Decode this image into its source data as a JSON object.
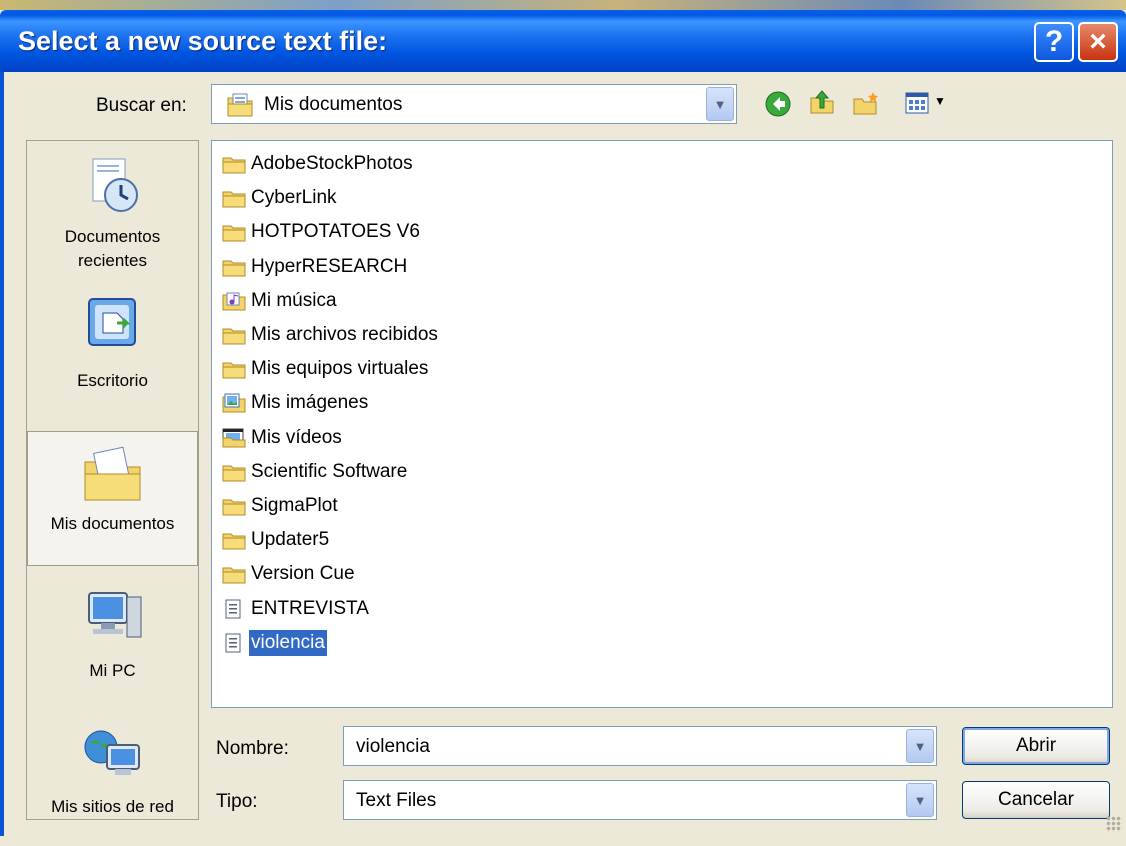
{
  "window": {
    "title": "Select a new source text file:",
    "help_icon": "?",
    "close_icon": "×"
  },
  "lookin": {
    "label": "Buscar en:",
    "value": "Mis documentos",
    "icon": "my-documents-icon"
  },
  "toolbar": {
    "icons": [
      "back-icon",
      "up-folder-icon",
      "new-folder-icon",
      "view-menu-icon"
    ]
  },
  "places": [
    {
      "label_line1": "Documentos",
      "label_line2": "recientes",
      "icon": "recent-documents-icon"
    },
    {
      "label_line1": "Escritorio",
      "label_line2": "",
      "icon": "desktop-icon"
    },
    {
      "label_line1": "Mis documentos",
      "label_line2": "",
      "icon": "my-documents-icon",
      "active": true
    },
    {
      "label_line1": "Mi PC",
      "label_line2": "",
      "icon": "my-computer-icon"
    },
    {
      "label_line1": "Mis sitios de red",
      "label_line2": "",
      "icon": "network-places-icon"
    }
  ],
  "files": [
    {
      "name": "AdobeStockPhotos",
      "type": "folder"
    },
    {
      "name": "CyberLink",
      "type": "folder"
    },
    {
      "name": "HOTPOTATOES V6",
      "type": "folder"
    },
    {
      "name": "HyperRESEARCH",
      "type": "folder"
    },
    {
      "name": "Mi música",
      "type": "music-folder"
    },
    {
      "name": "Mis archivos recibidos",
      "type": "folder"
    },
    {
      "name": "Mis equipos virtuales",
      "type": "folder"
    },
    {
      "name": "Mis imágenes",
      "type": "pictures-folder"
    },
    {
      "name": "Mis vídeos",
      "type": "video-folder"
    },
    {
      "name": "Scientific Software",
      "type": "folder"
    },
    {
      "name": "SigmaPlot",
      "type": "folder"
    },
    {
      "name": "Updater5",
      "type": "folder"
    },
    {
      "name": "Version Cue",
      "type": "folder"
    },
    {
      "name": "ENTREVISTA",
      "type": "text-file"
    },
    {
      "name": "violencia",
      "type": "text-file",
      "selected": true
    }
  ],
  "filename": {
    "label": "Nombre:",
    "value": "violencia"
  },
  "filetype": {
    "label": "Tipo:",
    "value": "Text Files"
  },
  "buttons": {
    "open": "Abrir",
    "cancel": "Cancelar"
  },
  "colors": {
    "title_bar": "#0058e6",
    "selection": "#316ac5",
    "dialog_bg": "#ece9d8"
  }
}
